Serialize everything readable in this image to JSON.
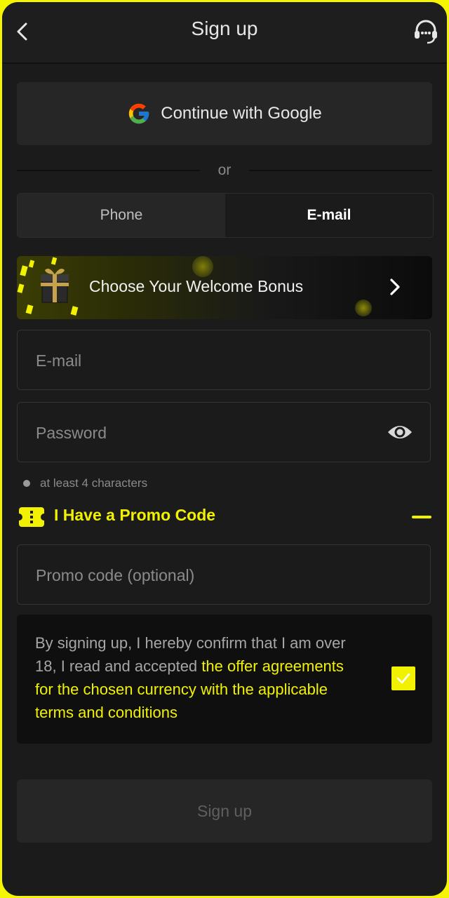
{
  "header": {
    "title": "Sign up",
    "back_icon": "chevron-left-icon",
    "support_icon": "headset-icon"
  },
  "google": {
    "label": "Continue with Google",
    "icon": "google-g-icon"
  },
  "divider": {
    "text": "or"
  },
  "tabs": [
    {
      "label": "Phone",
      "active": false
    },
    {
      "label": "E-mail",
      "active": true
    }
  ],
  "bonus": {
    "label": "Choose Your Welcome Bonus",
    "icon": "gift-box-icon"
  },
  "email": {
    "placeholder": "E-mail"
  },
  "password": {
    "placeholder": "Password",
    "icon": "eye-icon"
  },
  "password_hint": "at least 4 characters",
  "promo": {
    "label": "I Have a Promo Code",
    "placeholder": "Promo code (optional)",
    "icon": "ticket-icon"
  },
  "terms": {
    "text_plain": "By signing up, I hereby confirm that I am over 18, I read and accepted ",
    "text_link": "the offer agreements for the chosen currency with the applicable terms and conditions",
    "checked": true
  },
  "submit": {
    "label": "Sign up"
  },
  "colors": {
    "accent": "#f1f100",
    "background": "#1b1b1b",
    "surface": "#262626"
  }
}
